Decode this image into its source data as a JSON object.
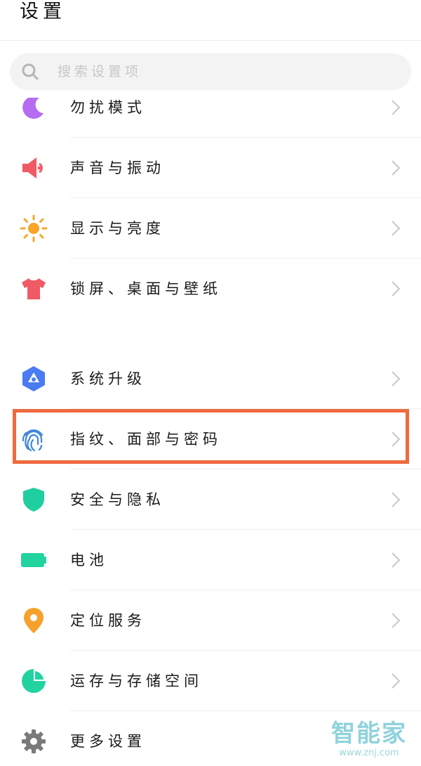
{
  "header": {
    "title": "设置"
  },
  "search": {
    "placeholder": "搜索设置项"
  },
  "items": [
    {
      "label": "勿扰模式",
      "icon": "moon-icon",
      "color": "#b56cf0"
    },
    {
      "label": "声音与振动",
      "icon": "speaker-icon",
      "color": "#f05a64"
    },
    {
      "label": "显示与亮度",
      "icon": "sun-icon",
      "color": "#f7a52b"
    },
    {
      "label": "锁屏、桌面与壁纸",
      "icon": "tshirt-icon",
      "color": "#f05a64"
    },
    {
      "label": "系统升级",
      "icon": "upgrade-icon",
      "color": "#4a7bf0"
    },
    {
      "label": "指纹、面部与密码",
      "icon": "fingerprint-icon",
      "color": "#3f86d8"
    },
    {
      "label": "安全与隐私",
      "icon": "shield-icon",
      "color": "#1fcfa0"
    },
    {
      "label": "电池",
      "icon": "battery-icon",
      "color": "#22d3a0"
    },
    {
      "label": "定位服务",
      "icon": "location-pin-icon",
      "color": "#f5a12b"
    },
    {
      "label": "运存与存储空间",
      "icon": "pie-chart-icon",
      "color": "#22d3a0"
    },
    {
      "label": "更多设置",
      "icon": "gear-icon",
      "color": "#7a7a7a"
    }
  ],
  "highlight_color": "#ee6a3f",
  "watermark": {
    "text": "智能家",
    "url": "www.znj.com"
  }
}
